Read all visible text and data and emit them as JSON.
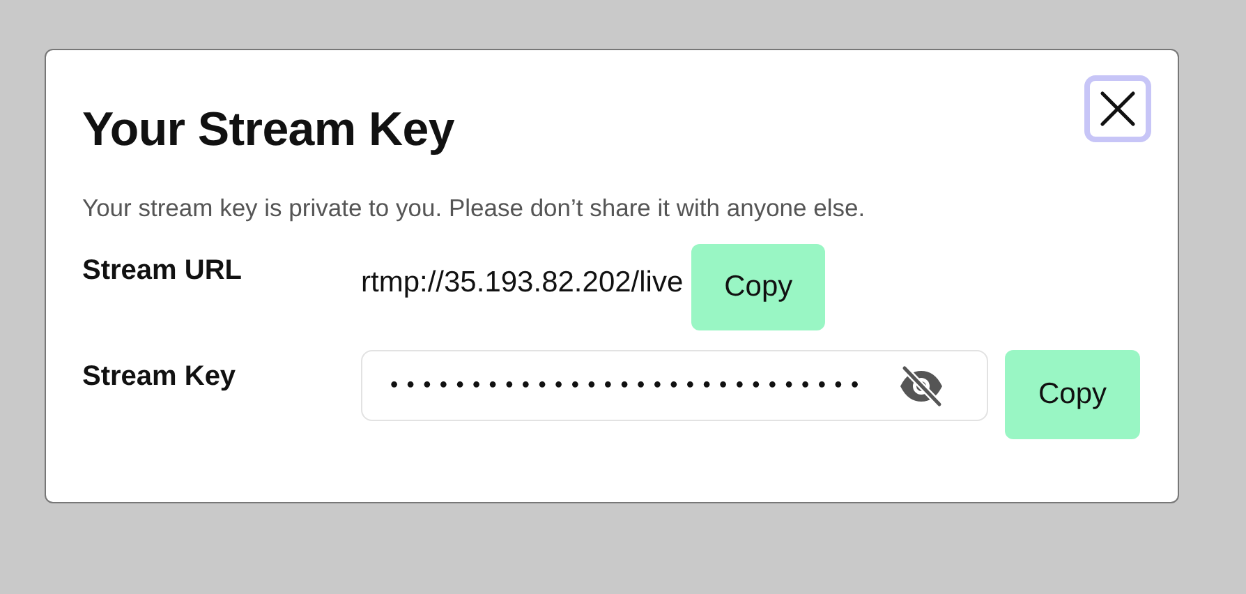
{
  "dialog": {
    "title": "Your Stream Key",
    "description": "Your stream key is private to you. Please don’t share it with anyone else.",
    "fields": [
      {
        "kind": "text",
        "label": "Stream URL",
        "value": "rtmp://35.193.82.202/live",
        "button": "Copy"
      },
      {
        "kind": "secret",
        "label": "Stream Key",
        "value": "•••••••••••••••••••••••••••••",
        "revealed": false,
        "button": "Copy"
      }
    ]
  }
}
